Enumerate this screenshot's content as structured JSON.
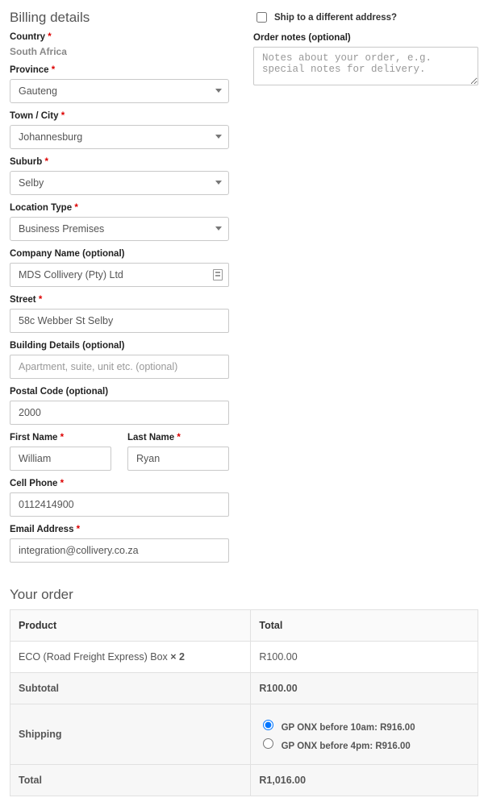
{
  "billing": {
    "heading": "Billing details",
    "country_label": "Country",
    "country_value": "South Africa",
    "province_label": "Province",
    "province_value": "Gauteng",
    "town_label": "Town / City",
    "town_value": "Johannesburg",
    "suburb_label": "Suburb",
    "suburb_value": "Selby",
    "location_label": "Location Type",
    "location_value": "Business Premises",
    "company_label": "Company Name (optional)",
    "company_value": "MDS Collivery (Pty) Ltd",
    "street_label": "Street",
    "street_value": "58c Webber St Selby",
    "building_label": "Building Details (optional)",
    "building_placeholder": "Apartment, suite, unit etc. (optional)",
    "postal_label": "Postal Code (optional)",
    "postal_value": "2000",
    "first_name_label": "First Name",
    "first_name_value": "William",
    "last_name_label": "Last Name",
    "last_name_value": "Ryan",
    "phone_label": "Cell Phone",
    "phone_value": "0112414900",
    "email_label": "Email Address",
    "email_value": "integration@collivery.co.za"
  },
  "shipping": {
    "ship_diff_label": "Ship to a different address?",
    "notes_label": "Order notes (optional)",
    "notes_placeholder": "Notes about your order, e.g. special notes for delivery."
  },
  "order": {
    "heading": "Your order",
    "col_product": "Product",
    "col_total": "Total",
    "item_name": "ECO (Road Freight Express) Box ",
    "item_qty": " × 2",
    "item_total": "R100.00",
    "subtotal_label": "Subtotal",
    "subtotal_value": "R100.00",
    "shipping_label": "Shipping",
    "ship_opt1": "GP ONX before 10am: R916.00",
    "ship_opt2": "GP ONX before 4pm: R916.00",
    "total_label": "Total",
    "total_value": "R1,016.00"
  }
}
